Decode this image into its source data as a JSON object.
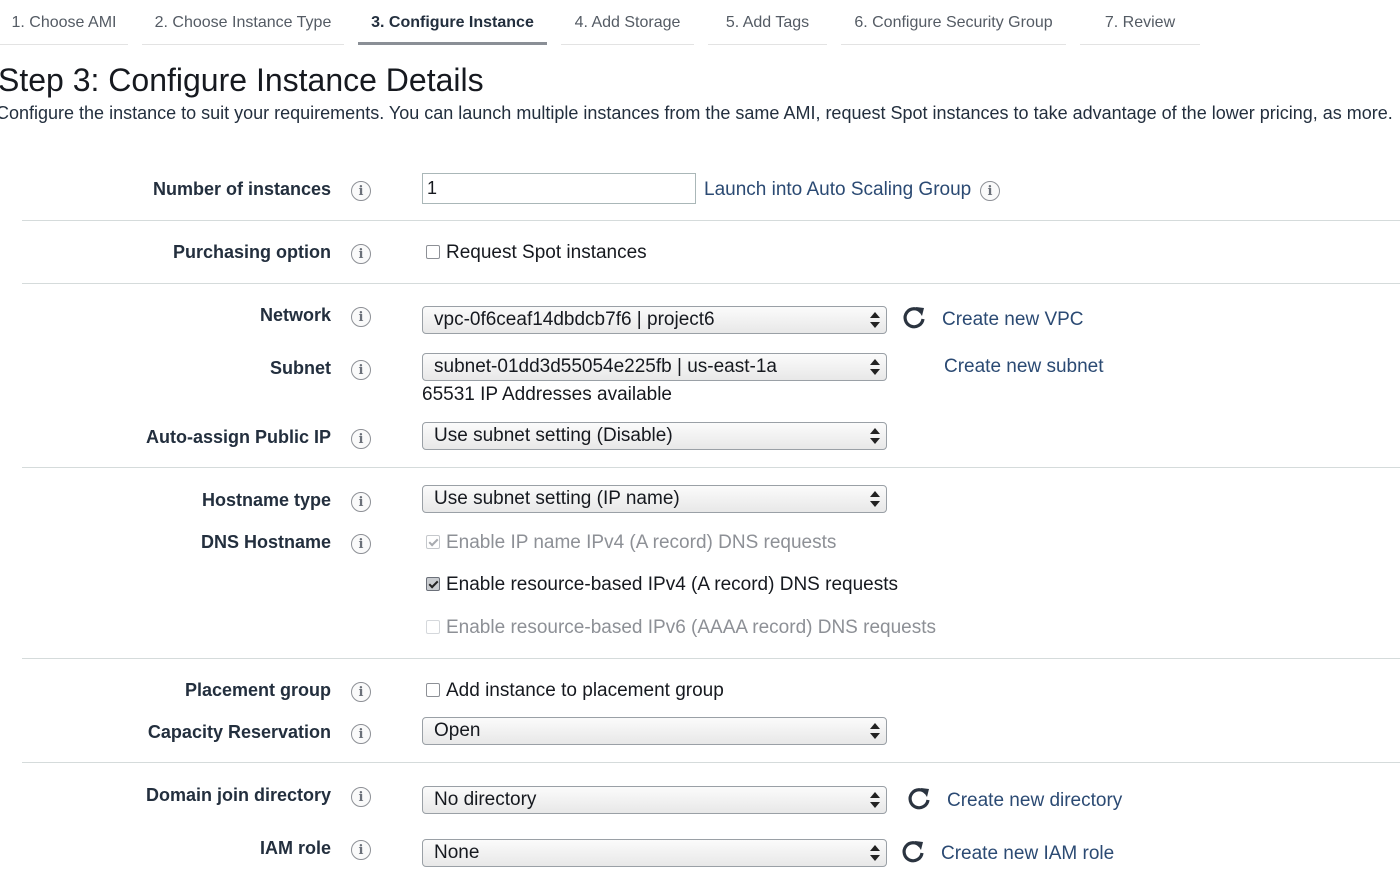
{
  "tabs": [
    {
      "label": "1. Choose AMI"
    },
    {
      "label": "2. Choose Instance Type"
    },
    {
      "label": "3. Configure Instance"
    },
    {
      "label": "4. Add Storage"
    },
    {
      "label": "5. Add Tags"
    },
    {
      "label": "6. Configure Security Group"
    },
    {
      "label": "7. Review"
    }
  ],
  "active_tab": "3. Configure Instance",
  "page": {
    "title": "Step 3: Configure Instance Details",
    "description": "Configure the instance to suit your requirements. You can launch multiple instances from the same AMI, request Spot instances to take advantage of the lower pricing, as more."
  },
  "fields": {
    "number_of_instances": {
      "label": "Number of instances",
      "value": "1",
      "link": "Launch into Auto Scaling Group"
    },
    "purchasing_option": {
      "label": "Purchasing option",
      "checkbox": "Request Spot instances",
      "checked": false
    },
    "network": {
      "label": "Network",
      "value": "vpc-0f6ceaf14dbdcb7f6 | project6",
      "link": "Create new VPC"
    },
    "subnet": {
      "label": "Subnet",
      "value": "subnet-01dd3d55054e225fb | us-east-1a",
      "link": "Create new subnet",
      "note": "65531 IP Addresses available"
    },
    "auto_assign_public_ip": {
      "label": "Auto-assign Public IP",
      "value": "Use subnet setting (Disable)"
    },
    "hostname_type": {
      "label": "Hostname type",
      "value": "Use subnet setting (IP name)"
    },
    "dns_hostname": {
      "label": "DNS Hostname",
      "options": [
        {
          "label": "Enable IP name IPv4 (A record) DNS requests",
          "checked": true,
          "disabled": true
        },
        {
          "label": "Enable resource-based IPv4 (A record) DNS requests",
          "checked": true,
          "disabled": false
        },
        {
          "label": "Enable resource-based IPv6 (AAAA record) DNS requests",
          "checked": false,
          "disabled": true
        }
      ]
    },
    "placement_group": {
      "label": "Placement group",
      "checkbox": "Add instance to placement group",
      "checked": false
    },
    "capacity_reservation": {
      "label": "Capacity Reservation",
      "value": "Open"
    },
    "domain_join_directory": {
      "label": "Domain join directory",
      "value": "No directory",
      "link": "Create new directory"
    },
    "iam_role": {
      "label": "IAM role",
      "value": "None",
      "link": "Create new IAM role"
    }
  },
  "icons": {
    "info": "info-icon",
    "refresh": "refresh-icon"
  },
  "colors": {
    "link": "#2b4a73",
    "text": "#232f3e",
    "muted": "#8d9096",
    "divider": "#d5dbdb"
  }
}
